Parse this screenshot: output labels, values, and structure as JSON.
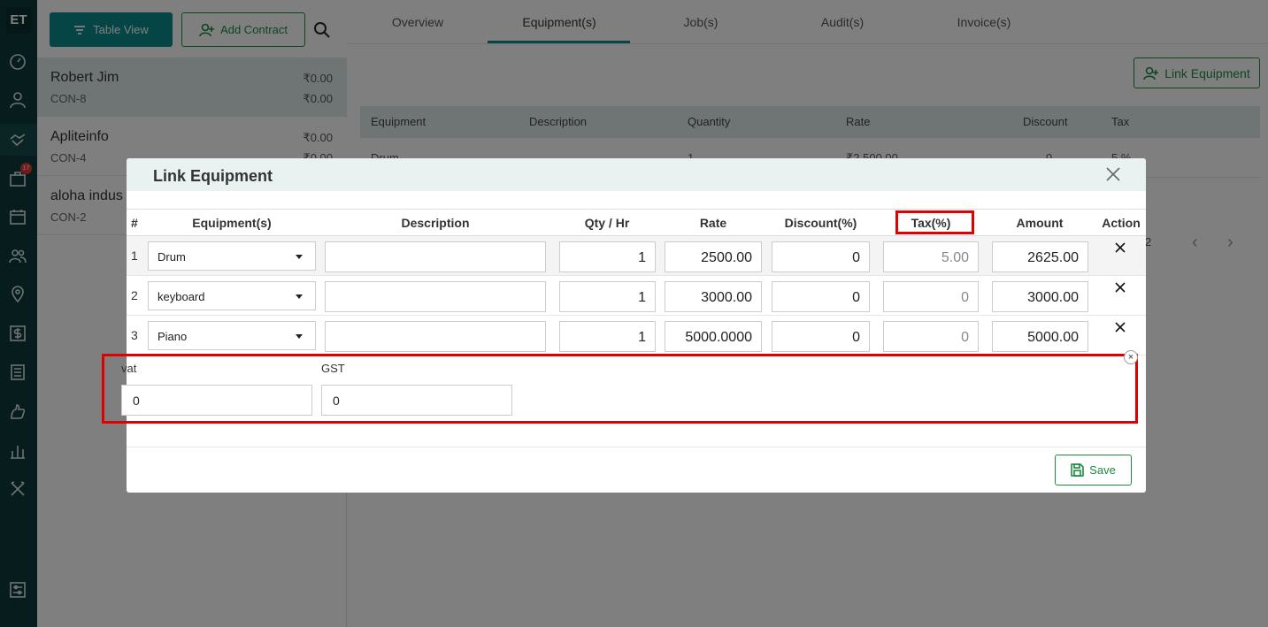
{
  "app": {
    "logo": "ET",
    "notification_count": "17"
  },
  "sidebar": {
    "icons": [
      "dashboard-icon",
      "user-icon",
      "handshake-icon",
      "briefcase-icon",
      "calendar-icon",
      "people-icon",
      "location-icon",
      "dollar-icon",
      "list-icon",
      "thumb-icon",
      "bar-chart-icon",
      "tools-icon",
      "settings-icon"
    ]
  },
  "toolbar": {
    "table_view_label": "Table View",
    "add_contract_label": "Add Contract"
  },
  "contracts": [
    {
      "name": "Robert Jim",
      "number": "CON-8",
      "amount1": "₹0.00",
      "amount2": "₹0.00"
    },
    {
      "name": "Apliteinfo",
      "number": "CON-4",
      "amount1": "₹0.00",
      "amount2": "₹0.00"
    },
    {
      "name": "aloha indus",
      "number": "CON-2",
      "amount1": "",
      "amount2": ""
    }
  ],
  "tabs": [
    "Overview",
    "Equipment(s)",
    "Job(s)",
    "Audit(s)",
    "Invoice(s)"
  ],
  "link_equipment_label": "Link Equipment",
  "equipment_table": {
    "headers": [
      "Equipment",
      "Description",
      "Quantity",
      "Rate",
      "Discount",
      "Tax"
    ],
    "row": [
      "Drum",
      "1",
      "₹2,500.00",
      "0",
      "5 %"
    ],
    "pager_text": "2"
  },
  "modal": {
    "title": "Link Equipment",
    "headers": [
      "#",
      "Equipment(s)",
      "Description",
      "Qty / Hr",
      "Rate",
      "Discount(%)",
      "Tax(%)",
      "Amount",
      "Action"
    ],
    "rows": [
      {
        "idx": "1",
        "equipment": "Drum",
        "description": "",
        "qty": "1",
        "rate": "2500.00",
        "discount": "0",
        "tax": "5.00",
        "amount": "2625.00"
      },
      {
        "idx": "2",
        "equipment": "keyboard",
        "description": "",
        "qty": "1",
        "rate": "3000.00",
        "discount": "0",
        "tax": "0",
        "amount": "3000.00"
      },
      {
        "idx": "3",
        "equipment": "Piano",
        "description": "",
        "qty": "1",
        "rate": "5000.0000",
        "discount": "0",
        "tax": "0",
        "amount": "5000.00"
      }
    ],
    "tax_fields": [
      {
        "label": "vat",
        "value": "0"
      },
      {
        "label": "GST",
        "value": "0"
      }
    ],
    "save_label": "Save"
  },
  "colors": {
    "primary": "#0d8a8a",
    "green": "#1b8c3e",
    "highlight": "#e00000",
    "rail": "#0f3a3a"
  }
}
